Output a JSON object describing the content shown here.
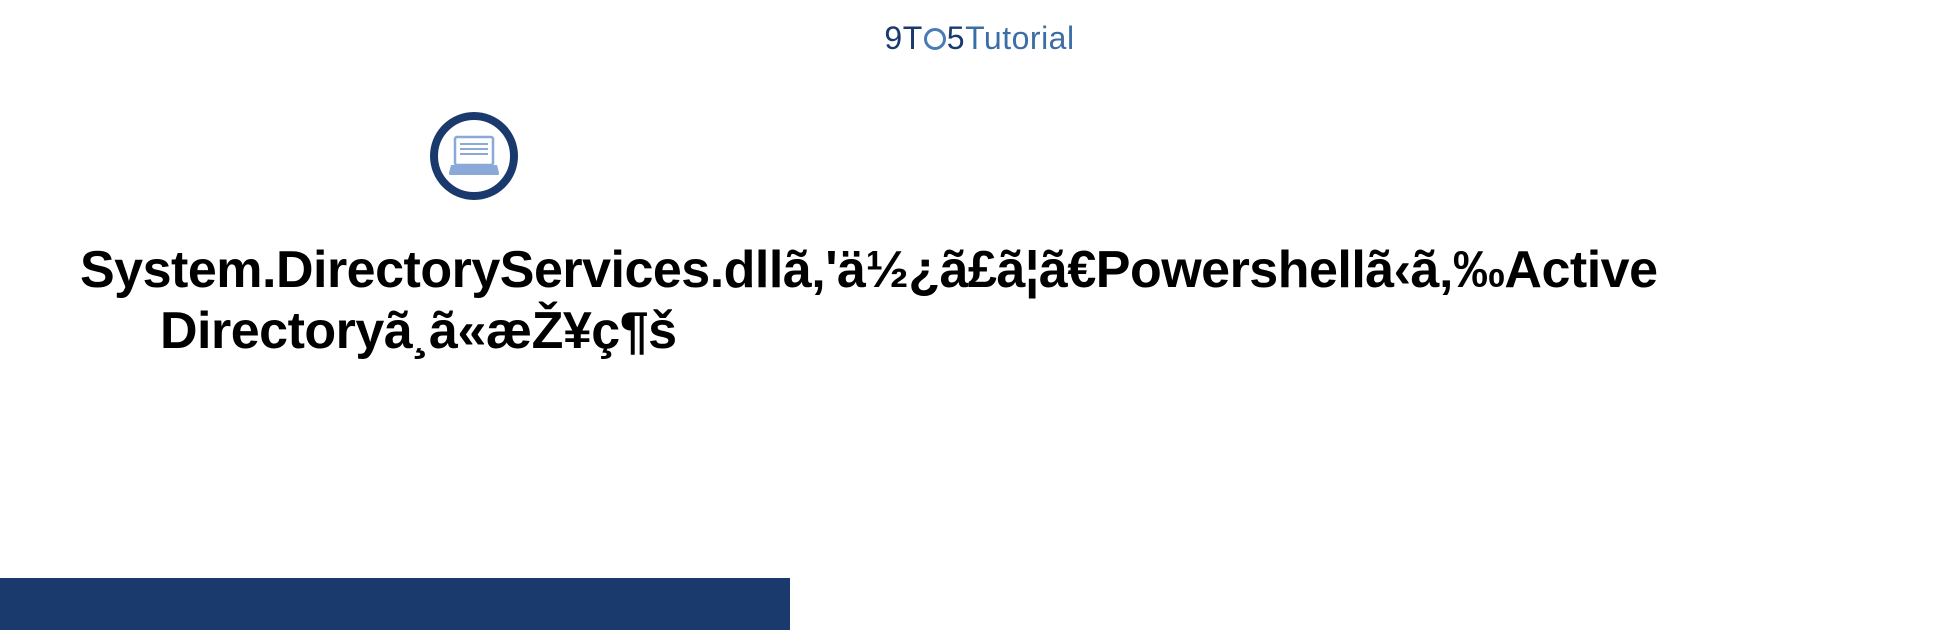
{
  "brand": {
    "part1": "9T",
    "part2": "5",
    "part3": "Tutorial"
  },
  "article": {
    "title_line1": "System.DirectoryServices.dllã‚'ä½¿ã£ã¦ã€Powershellã‹ã‚‰Active",
    "title_line2": "Directoryã¸ã«æŽ¥ç¶š"
  },
  "colors": {
    "brand_dark": "#1a3a6e",
    "brand_light": "#3b6ea5",
    "icon_fill": "#8aa8d8"
  }
}
